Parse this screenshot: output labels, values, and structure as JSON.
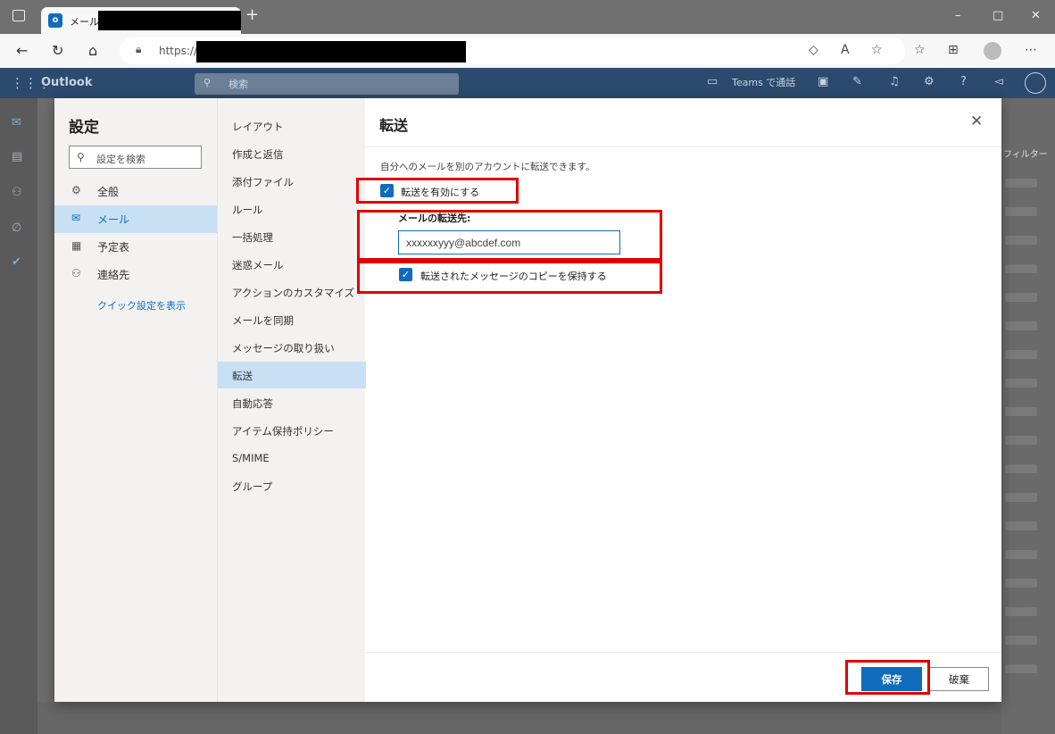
{
  "browser": {
    "tab_title": "メール -",
    "url": "https://",
    "new_tab": "+",
    "win_min": "–",
    "win_max": "□",
    "win_close": "✕"
  },
  "outlook": {
    "brand": "Outlook",
    "search_placeholder": "検索",
    "teams_call": "Teams で通話"
  },
  "background": {
    "filter_label": "フィルター"
  },
  "settings": {
    "title": "設定",
    "search_placeholder": "設定を検索",
    "categories": [
      {
        "label": "全般",
        "icon": "gear-icon"
      },
      {
        "label": "メール",
        "icon": "mail-icon"
      },
      {
        "label": "予定表",
        "icon": "calendar-icon"
      },
      {
        "label": "連絡先",
        "icon": "people-icon"
      }
    ],
    "quick_settings": "クイック設定を表示",
    "subcategories": [
      "レイアウト",
      "作成と返信",
      "添付ファイル",
      "ルール",
      "一括処理",
      "迷惑メール",
      "アクションのカスタマイズ",
      "メールを同期",
      "メッセージの取り扱い",
      "転送",
      "自動応答",
      "アイテム保持ポリシー",
      "S/MIME",
      "グループ"
    ]
  },
  "forwarding": {
    "title": "転送",
    "description": "自分へのメールを別のアカウントに転送できます。",
    "enable_label": "転送を有効にする",
    "enable_checked": true,
    "address_label": "メールの転送先:",
    "address_value": "xxxxxxyyy@abcdef.com",
    "keep_copy_label": "転送されたメッセージのコピーを保持する",
    "keep_copy_checked": true,
    "save_label": "保存",
    "discard_label": "破棄"
  },
  "colors": {
    "accent": "#0f6cbd",
    "highlight": "#e00000",
    "selected_bg": "#c7e0f4"
  }
}
